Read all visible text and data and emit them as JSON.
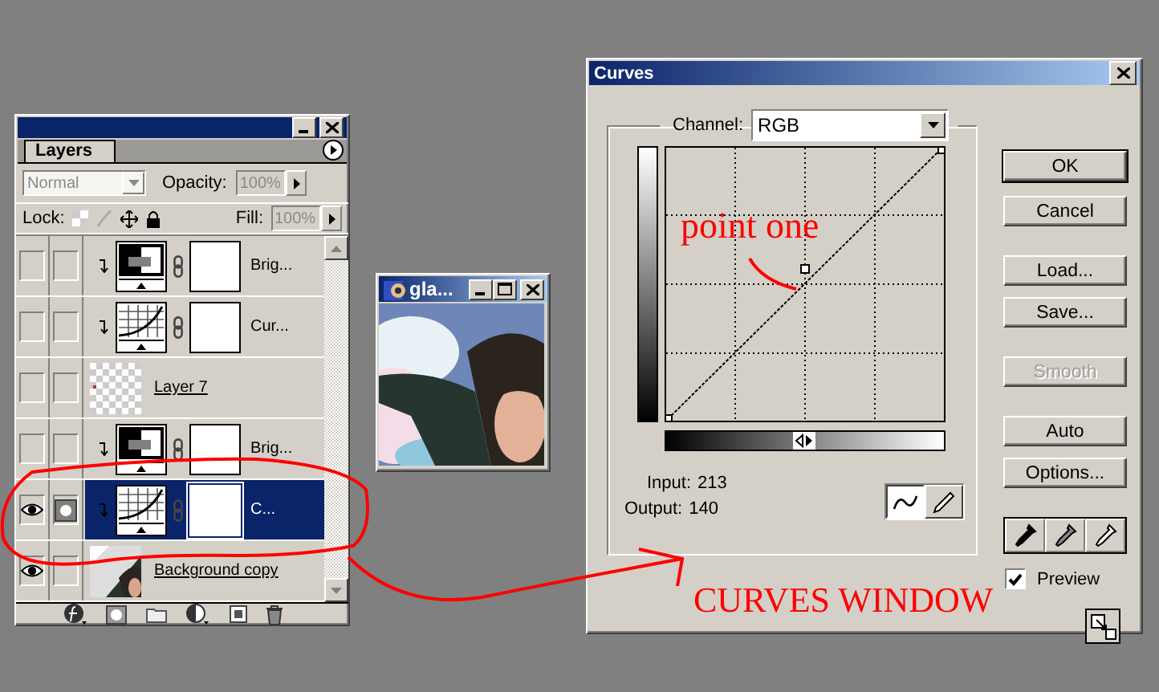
{
  "layers_panel": {
    "tab": "Layers",
    "blend_mode": "Normal",
    "opacity_label": "Opacity:",
    "opacity": "100%",
    "lock_label": "Lock:",
    "fill_label": "Fill:",
    "fill": "100%",
    "layers": [
      {
        "kind": "brightness",
        "name": "Brig...",
        "visible": false,
        "mask_active": false,
        "selected": false
      },
      {
        "kind": "curves",
        "name": "Cur...",
        "visible": false,
        "mask_active": false,
        "selected": false
      },
      {
        "kind": "empty",
        "name": "Layer 7",
        "visible": false,
        "mask_active": false,
        "selected": false
      },
      {
        "kind": "brightness",
        "name": "Brig...",
        "visible": false,
        "mask_active": false,
        "selected": false
      },
      {
        "kind": "curves",
        "name": "C...",
        "visible": true,
        "mask_active": true,
        "selected": true
      },
      {
        "name": "Background copy",
        "visible": true,
        "mask_active": false,
        "selected": false
      }
    ]
  },
  "doc_window": {
    "title": "gla..."
  },
  "curves": {
    "title": "Curves",
    "channel_label": "Channel:",
    "channel": "RGB",
    "input_label": "Input:",
    "input": "213",
    "output_label": "Output:",
    "output": "140",
    "tools": [
      {
        "kind": "curve",
        "selected": true
      },
      {
        "kind": "pencil",
        "selected": false
      }
    ],
    "button_groups": [
      [
        {
          "label": "OK",
          "default": true,
          "disabled": false
        },
        {
          "label": "Cancel",
          "default": false,
          "disabled": false
        }
      ],
      [
        {
          "label": "Load...",
          "default": false,
          "disabled": false
        },
        {
          "label": "Save...",
          "default": false,
          "disabled": false
        }
      ],
      [
        {
          "label": "Smooth",
          "default": false,
          "disabled": true
        }
      ],
      [
        {
          "label": "Auto",
          "default": false,
          "disabled": false
        },
        {
          "label": "Options...",
          "default": false,
          "disabled": false
        }
      ]
    ],
    "eyedroppers": [
      {
        "kind": "black"
      },
      {
        "kind": "gray"
      },
      {
        "kind": "white"
      }
    ],
    "preview": {
      "label": "Preview",
      "checked": true
    }
  },
  "annotations": [
    {
      "kind": "point_label",
      "text": "point one"
    },
    {
      "kind": "window_label",
      "text": "CURVES WINDOW"
    }
  ]
}
